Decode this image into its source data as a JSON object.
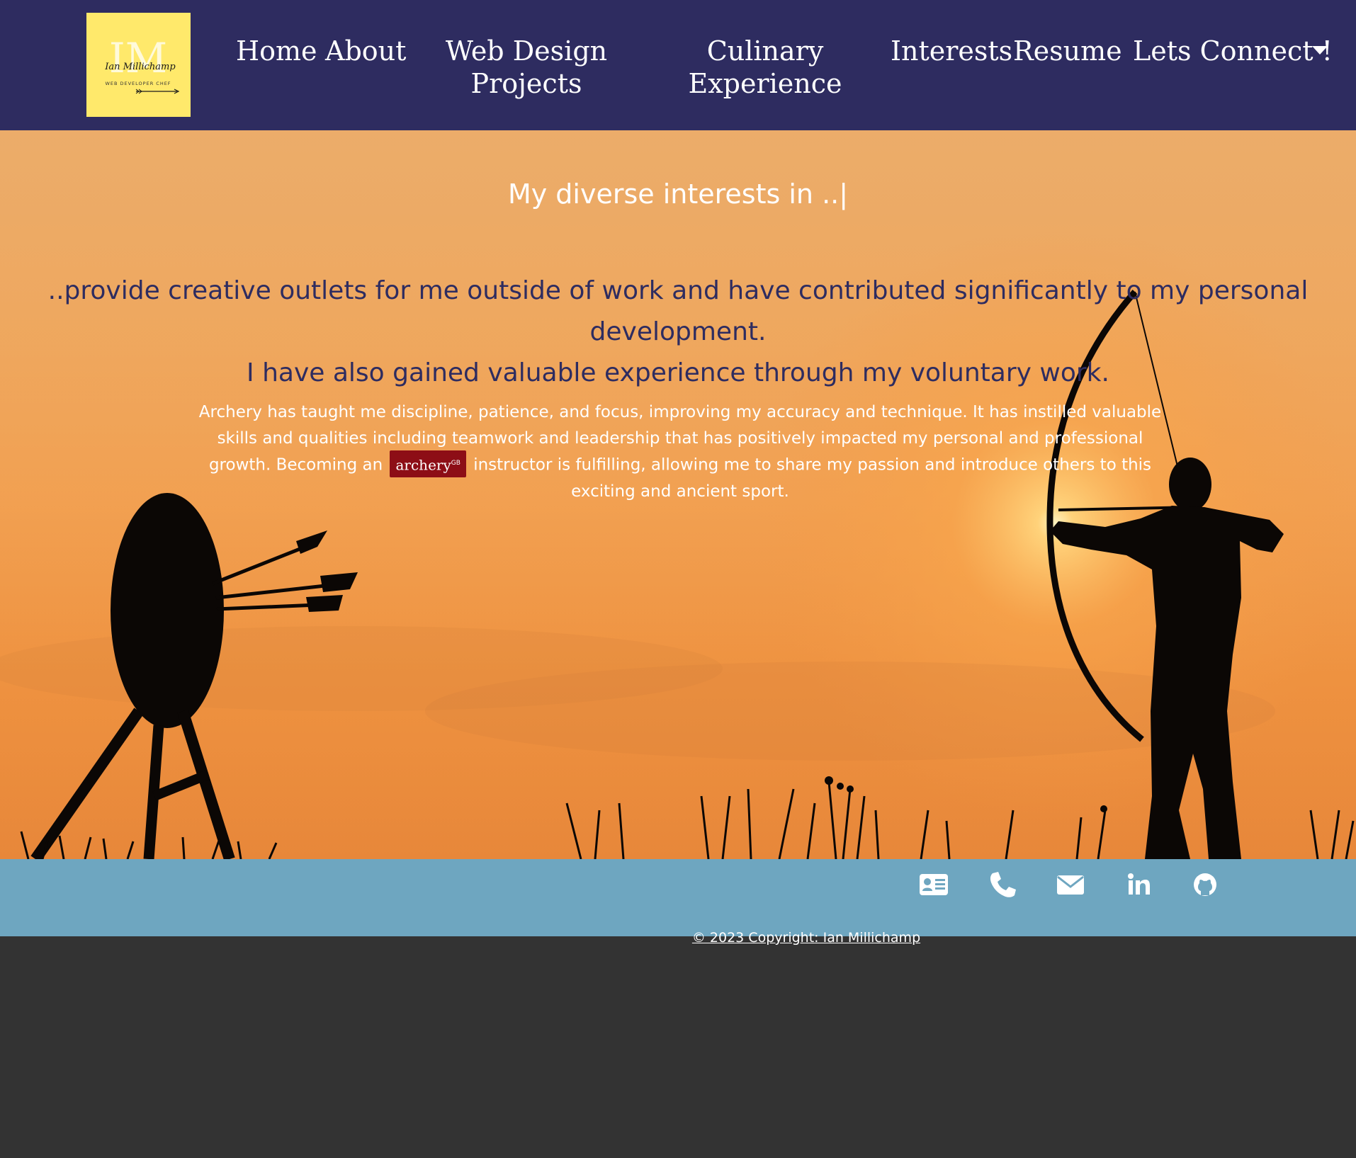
{
  "navbar": {
    "logo": {
      "monogram": "IM",
      "signature": "Ian Millichamp",
      "tagline": "WEB DEVELOPER CHEF"
    },
    "links": {
      "home": "Home",
      "about": "About",
      "web_design": "Web Design Projects",
      "culinary": "Culinary Experience",
      "interests": "Interests",
      "resume": "Resume",
      "connect": "Lets Connect !"
    }
  },
  "hero": {
    "heading": "My diverse interests in ..|",
    "lead_line1": "..provide creative outlets for me outside of work and have contributed significantly to my personal development.",
    "lead_line2": "I have also gained valuable experience through my voluntary work.",
    "body_part1": "Archery has taught me discipline, patience, and focus, improving my accuracy and technique. It has instilled valuable skills and qualities including teamwork and leadership that has positively impacted my personal and professional growth. Becoming an",
    "badge_text": "archery",
    "badge_suffix": "GB",
    "body_part2": "instructor is fulfilling, allowing me to share my passion and introduce others to this exciting and ancient sport."
  },
  "footer": {
    "icons": [
      "contact-card-icon",
      "phone-icon",
      "envelope-icon",
      "linkedin-icon",
      "github-icon"
    ],
    "copyright": "© 2023 Copyright: Ian Millichamp"
  },
  "colors": {
    "navbar_bg": "#2e2c60",
    "logo_bg": "#ffe96b",
    "lead_text": "#2e2c60",
    "footer_bg": "#6ea6c0",
    "page_bg": "#333333",
    "badge_bg": "#8d0e16"
  }
}
